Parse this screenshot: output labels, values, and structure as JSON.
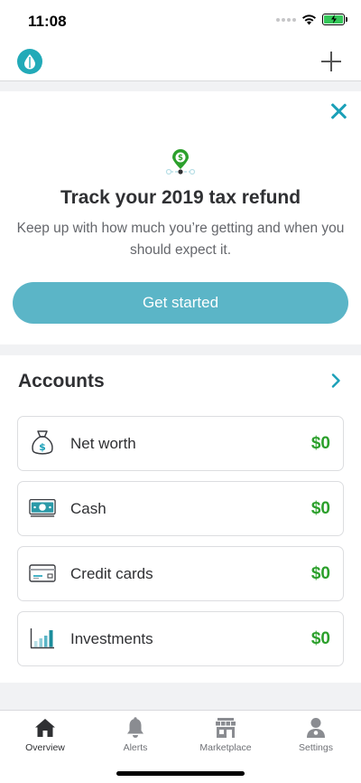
{
  "status_bar": {
    "time": "11:08"
  },
  "colors": {
    "brand_teal": "#22aab8",
    "button_teal": "#5bb5c7",
    "value_green": "#2ca02c",
    "promo_pin": "#2ca02c"
  },
  "nav": {
    "logo_icon": "drop-logo-icon",
    "add_icon": "plus-icon"
  },
  "promo": {
    "title": "Track your 2019 tax refund",
    "description": "Keep up with how much you’re getting and when you should expect it.",
    "button_label": "Get started",
    "close_icon": "close-icon",
    "pin_icon": "dollar-pin-icon"
  },
  "accounts": {
    "title": "Accounts",
    "items": [
      {
        "label": "Net worth",
        "value": "$0",
        "icon": "money-bag-icon"
      },
      {
        "label": "Cash",
        "value": "$0",
        "icon": "cash-icon"
      },
      {
        "label": "Credit cards",
        "value": "$0",
        "icon": "credit-card-icon"
      },
      {
        "label": "Investments",
        "value": "$0",
        "icon": "investments-chart-icon"
      }
    ]
  },
  "tabs": [
    {
      "label": "Overview",
      "icon": "home-icon",
      "active": true
    },
    {
      "label": "Alerts",
      "icon": "bell-icon",
      "active": false
    },
    {
      "label": "Marketplace",
      "icon": "storefront-icon",
      "active": false
    },
    {
      "label": "Settings",
      "icon": "person-icon",
      "active": false
    }
  ]
}
